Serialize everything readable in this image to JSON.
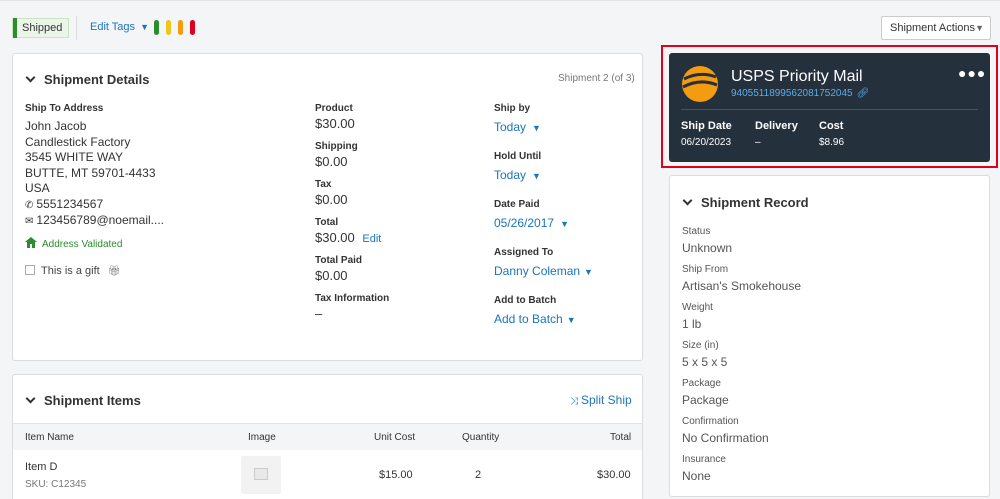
{
  "topbar": {
    "status_badge": "Shipped",
    "edit_tags": "Edit Tags",
    "tag_colors": [
      "#2e8b2e",
      "#f0c419",
      "#f39c12",
      "#e0001b"
    ],
    "shipment_actions": "Shipment Actions"
  },
  "details": {
    "title": "Shipment Details",
    "counter": "Shipment 2 (of 3)",
    "ship_to_label": "Ship To Address",
    "name": "John Jacob",
    "company": "Candlestick Factory",
    "street": "3545 WHITE WAY",
    "city": "BUTTE, MT 59701-4433",
    "country": "USA",
    "phone": "5551234567",
    "email": "123456789@noemail....",
    "address_validated": "Address Validated",
    "gift_label": "This is a gift",
    "product_label": "Product",
    "product_value": "$30.00",
    "shipping_label": "Shipping",
    "shipping_value": "$0.00",
    "tax_label": "Tax",
    "tax_value": "$0.00",
    "total_label": "Total",
    "total_value": "$30.00",
    "total_edit": "Edit",
    "total_paid_label": "Total Paid",
    "total_paid_value": "$0.00",
    "tax_info_label": "Tax Information",
    "tax_info_value": "–",
    "ship_by_label": "Ship by",
    "ship_by_value": "Today",
    "hold_until_label": "Hold Until",
    "hold_until_value": "Today",
    "date_paid_label": "Date Paid",
    "date_paid_value": "05/26/2017",
    "assigned_label": "Assigned To",
    "assigned_value": "Danny Coleman",
    "batch_label": "Add to Batch",
    "batch_value": "Add to Batch"
  },
  "items": {
    "title": "Shipment Items",
    "split_ship": "Split Ship",
    "columns": [
      "Item Name",
      "Image",
      "Unit Cost",
      "Quantity",
      "Total"
    ],
    "rows": [
      {
        "name": "Item D",
        "sku": "SKU: C12345",
        "unit_cost": "$15.00",
        "quantity": "2",
        "total": "$30.00"
      }
    ]
  },
  "carrier": {
    "service": "USPS Priority Mail",
    "tracking": "9405511899562081752045",
    "ship_date_label": "Ship Date",
    "ship_date_value": "06/20/2023",
    "delivery_label": "Delivery",
    "delivery_value": "–",
    "cost_label": "Cost",
    "cost_value": "$8.96",
    "more_icon": "more-icon"
  },
  "record": {
    "title": "Shipment Record",
    "fields": [
      {
        "label": "Status",
        "value": "Unknown"
      },
      {
        "label": "Ship From",
        "value": "Artisan's Smokehouse"
      },
      {
        "label": "Weight",
        "value": "1 lb"
      },
      {
        "label": "Size (in)",
        "value": "5 x 5 x 5"
      },
      {
        "label": "Package",
        "value": "Package"
      },
      {
        "label": "Confirmation",
        "value": "No Confirmation"
      },
      {
        "label": "Insurance",
        "value": "None"
      }
    ]
  }
}
